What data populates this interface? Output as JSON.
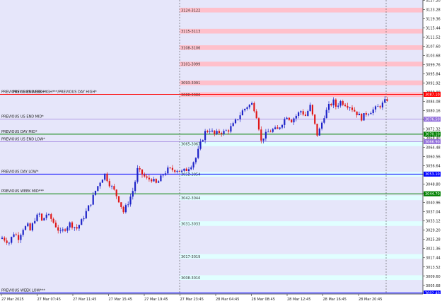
{
  "colors": {
    "background": "#e6e6fa",
    "bull": "#1e24c8",
    "bear": "#e01818",
    "red_zone": "#ffc0cb",
    "blue_zone": "#e0ffff",
    "red_line": "#ff0000",
    "green_line": "#008000",
    "blue_line": "#0000ff",
    "purple_line": "#9370db",
    "current_price_tag": "#ff0000"
  },
  "chart_data": {
    "type": "candlestick",
    "ylim": [
      3002.0,
      3127.3
    ],
    "x_ticks": [
      "27 Mar 2025",
      "27 Mar 07:45",
      "27 Mar 11:45",
      "27 Mar 15:45",
      "27 Mar 19:45",
      "27 Mar 23:45",
      "28 Mar 04:45",
      "28 Mar 08:45",
      "28 Mar 12:45",
      "28 Mar 16:45",
      "28 Mar 20:45"
    ],
    "y_ticks": [
      "3127.20",
      "3123.28",
      "3119.36",
      "3115.44",
      "3111.52",
      "3107.60",
      "3103.68",
      "3099.76",
      "3095.84",
      "3091.92",
      "3088.00",
      "3084.08",
      "3080.16",
      "3076.24",
      "3072.32",
      "3068.40",
      "3064.48",
      "3060.56",
      "3056.64",
      "3052.72",
      "3048.80",
      "3044.88",
      "3040.96",
      "3037.04",
      "3033.12",
      "3029.20",
      "3025.28",
      "3021.36",
      "3017.44",
      "3013.52",
      "3009.60",
      "3005.68"
    ],
    "zones": [
      {
        "label": "3124-3122",
        "low": 3122,
        "high": 3124,
        "color": "red"
      },
      {
        "label": "3115-3113",
        "low": 3113,
        "high": 3115,
        "color": "red"
      },
      {
        "label": "3108-3106",
        "low": 3106,
        "high": 3108,
        "color": "red"
      },
      {
        "label": "3101-3099",
        "low": 3099,
        "high": 3101,
        "color": "red"
      },
      {
        "label": "3093-3091",
        "low": 3091,
        "high": 3093,
        "color": "red"
      },
      {
        "label": "3088-3086",
        "low": 3086,
        "high": 3088,
        "color": "red"
      },
      {
        "label": "3065-3067",
        "low": 3065,
        "high": 3067,
        "color": "blue"
      },
      {
        "label": "3052-3054",
        "low": 3052,
        "high": 3054,
        "color": "blue"
      },
      {
        "label": "3042-3044",
        "low": 3042,
        "high": 3044,
        "color": "blue"
      },
      {
        "label": "3031-3033",
        "low": 3031,
        "high": 3033,
        "color": "blue"
      },
      {
        "label": "3017-3019",
        "low": 3017,
        "high": 3019,
        "color": "blue"
      },
      {
        "label": "3008-3010",
        "low": 3008,
        "high": 3010,
        "color": "blue"
      }
    ],
    "levels": [
      {
        "label": "PREVIOUS WEEK HIGH***/PREVIOUS DAY HIGH*",
        "price": 3087.1,
        "color": "red",
        "tag": "3087.10",
        "label_prefix": "PREVIOUS US END HIGH*"
      },
      {
        "label": "PREVIOUS US END MID*",
        "price": 3076.5,
        "color": "purple",
        "tag": "3076.50"
      },
      {
        "label": "PREVIOUS DAY MID*",
        "price": 3070.1,
        "color": "green",
        "tag": "3070.10"
      },
      {
        "label": "PREVIOUS US END LOW*",
        "price": 3066.9,
        "color": "purple",
        "tag": "3066.90"
      },
      {
        "label": "PREVIOUS DAY LOW*",
        "price": 3053.1,
        "color": "blue",
        "tag": "3053.10"
      },
      {
        "label": "PREVIOUS WEEK MID***",
        "price": 3044.7,
        "color": "green",
        "tag": "3044.70"
      },
      {
        "label": "PREVIOUS WEEK LOW***",
        "price": 3002.4,
        "color": "blue",
        "tag": "3002.40"
      }
    ],
    "current_price": 3087.1,
    "current_price_tag": "3087.10",
    "close_path": [
      [
        0,
        3026
      ],
      [
        3,
        3024
      ],
      [
        5,
        3028
      ],
      [
        7,
        3026
      ],
      [
        9,
        3030
      ],
      [
        11,
        3031
      ],
      [
        12,
        3029
      ],
      [
        14,
        3034
      ],
      [
        16,
        3036
      ],
      [
        17,
        3033
      ],
      [
        19,
        3036
      ],
      [
        21,
        3034
      ],
      [
        23,
        3031
      ],
      [
        25,
        3028
      ],
      [
        27,
        3030
      ],
      [
        29,
        3032
      ],
      [
        32,
        3030
      ],
      [
        34,
        3033
      ],
      [
        36,
        3037
      ],
      [
        38,
        3041
      ],
      [
        40,
        3046
      ],
      [
        42,
        3050
      ],
      [
        44,
        3053
      ],
      [
        45,
        3051
      ],
      [
        46,
        3049
      ],
      [
        48,
        3046
      ],
      [
        50,
        3042
      ],
      [
        52,
        3037
      ],
      [
        54,
        3041
      ],
      [
        56,
        3046
      ],
      [
        57,
        3050
      ],
      [
        58,
        3055
      ],
      [
        60,
        3053
      ],
      [
        62,
        3051
      ],
      [
        64,
        3051
      ],
      [
        66,
        3049
      ],
      [
        67,
        3050
      ],
      [
        69,
        3053
      ],
      [
        71,
        3055
      ],
      [
        73,
        3055
      ],
      [
        75,
        3055
      ],
      [
        77,
        3054
      ],
      [
        79,
        3055
      ],
      [
        81,
        3057
      ],
      [
        83,
        3060
      ],
      [
        85,
        3066
      ],
      [
        87,
        3071
      ],
      [
        89,
        3072
      ],
      [
        91,
        3070
      ],
      [
        93,
        3071
      ],
      [
        95,
        3071
      ],
      [
        97,
        3072
      ],
      [
        99,
        3074
      ],
      [
        101,
        3077
      ],
      [
        103,
        3080
      ],
      [
        105,
        3082
      ],
      [
        107,
        3083
      ],
      [
        108,
        3081
      ],
      [
        109,
        3078
      ],
      [
        110,
        3073
      ],
      [
        111,
        3067
      ],
      [
        112,
        3069
      ],
      [
        114,
        3071
      ],
      [
        116,
        3072
      ],
      [
        118,
        3072
      ],
      [
        120,
        3075
      ],
      [
        122,
        3078
      ],
      [
        124,
        3076
      ],
      [
        126,
        3078
      ],
      [
        128,
        3080
      ],
      [
        130,
        3078
      ],
      [
        132,
        3082
      ],
      [
        134,
        3074
      ],
      [
        135,
        3070
      ],
      [
        136,
        3072
      ],
      [
        138,
        3078
      ],
      [
        140,
        3082
      ],
      [
        142,
        3084
      ],
      [
        143,
        3082
      ],
      [
        145,
        3084
      ],
      [
        147,
        3083
      ],
      [
        149,
        3082
      ],
      [
        151,
        3080
      ],
      [
        153,
        3078
      ],
      [
        154,
        3077
      ],
      [
        156,
        3079
      ],
      [
        158,
        3080
      ],
      [
        160,
        3081
      ],
      [
        163,
        3083
      ],
      [
        165,
        3085
      ]
    ],
    "total_candles": 166,
    "last_visible_candle": 165,
    "vertical_markers": [
      70,
      149
    ]
  }
}
